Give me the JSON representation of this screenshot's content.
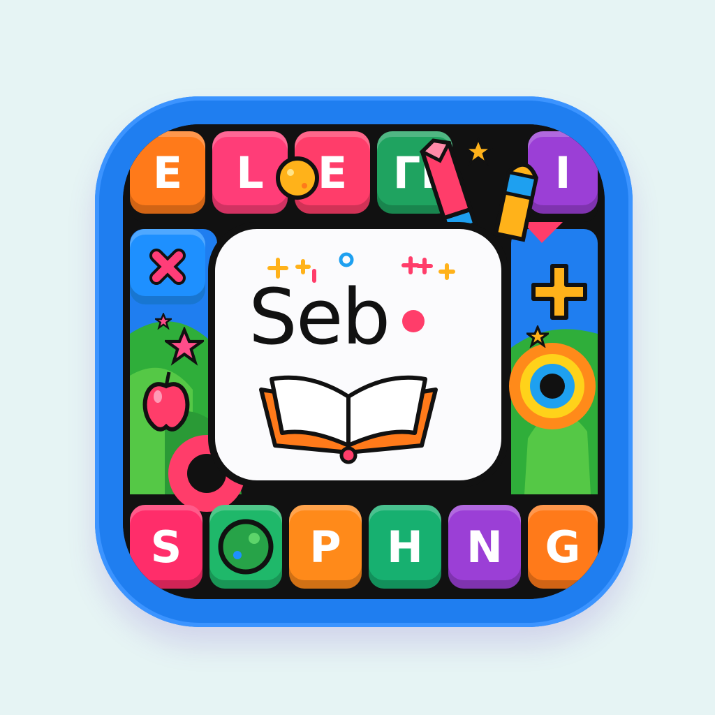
{
  "top_tiles": [
    {
      "letter": "E",
      "color": "#ff7a1a"
    },
    {
      "letter": "L",
      "color": "#ff3d78"
    },
    {
      "letter": "E",
      "color": "#ff3d6a"
    },
    {
      "letter": "ГІ",
      "color": "#1fa360"
    },
    {
      "letter": "I",
      "color": "#9b3fd6"
    }
  ],
  "bottom_tiles": [
    {
      "letter": "S",
      "color": "#ff2d6a"
    },
    {
      "letter": "",
      "color": "#1fb86a"
    },
    {
      "letter": "P",
      "color": "#ff8a1a"
    },
    {
      "letter": "H",
      "color": "#17b070"
    },
    {
      "letter": "N",
      "color": "#9b3fd6"
    },
    {
      "letter": "G",
      "color": "#ff7a1a"
    }
  ],
  "logo": {
    "text": "Seb"
  },
  "icons": {
    "book": "open-book-icon",
    "pencil": "pencil-icon",
    "crayon": "crayon-icon",
    "apple": "apple-icon",
    "globe": "globe-icon",
    "star": "star-icon",
    "plus": "plus-icon",
    "close": "close-icon"
  },
  "colors": {
    "frame": "#1f7ef0",
    "background": "#e6f4f4",
    "accent_pink": "#ff3d6a",
    "accent_yellow": "#ffb21a",
    "accent_blue": "#1ea0f0"
  }
}
